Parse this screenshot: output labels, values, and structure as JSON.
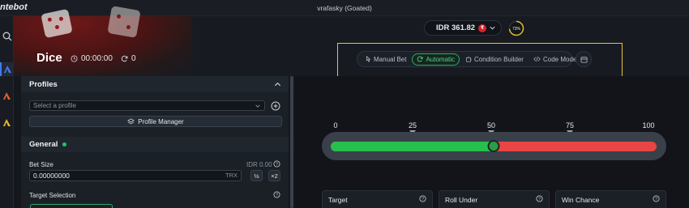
{
  "app": {
    "logo_text": "ntebot",
    "user_label": "vrafasky (Goated)"
  },
  "hero": {
    "title": "Dice",
    "timer": "00:00:00",
    "rounds": "0"
  },
  "balance": {
    "amount": "IDR 361.82",
    "coin_symbol": "₹",
    "progress_label": "73%",
    "progress_fraction": 0.73
  },
  "modes": [
    {
      "label": "Manual Bet",
      "icon": "pointer-icon",
      "active": false
    },
    {
      "label": "Automatic",
      "icon": "refresh-icon",
      "active": true
    },
    {
      "label": "Condition Builder",
      "icon": "puzzle-icon",
      "active": false
    },
    {
      "label": "Code Mode",
      "icon": "code-icon",
      "active": false
    }
  ],
  "profiles": {
    "heading": "Profiles",
    "select_placeholder": "Select a profile",
    "manager_label": "Profile Manager"
  },
  "general": {
    "heading": "General",
    "bet_size_label": "Bet Size",
    "bet_size_idr": "IDR 0.00",
    "bet_value": "0.00000000",
    "bet_unit": "TRX",
    "half_label": "½",
    "double_label": "×2",
    "target_selection_label": "Target Selection"
  },
  "slider": {
    "ticks": [
      "0",
      "25",
      "50",
      "75",
      "100"
    ],
    "value": 50
  },
  "cards": [
    {
      "title": "Target"
    },
    {
      "title": "Roll Under"
    },
    {
      "title": "Win Chance"
    }
  ],
  "colors": {
    "accent_green": "#27c04f",
    "accent_red": "#e84545",
    "highlight_frame": "#e6c13b",
    "brand_blue": "#3f7bf2"
  }
}
